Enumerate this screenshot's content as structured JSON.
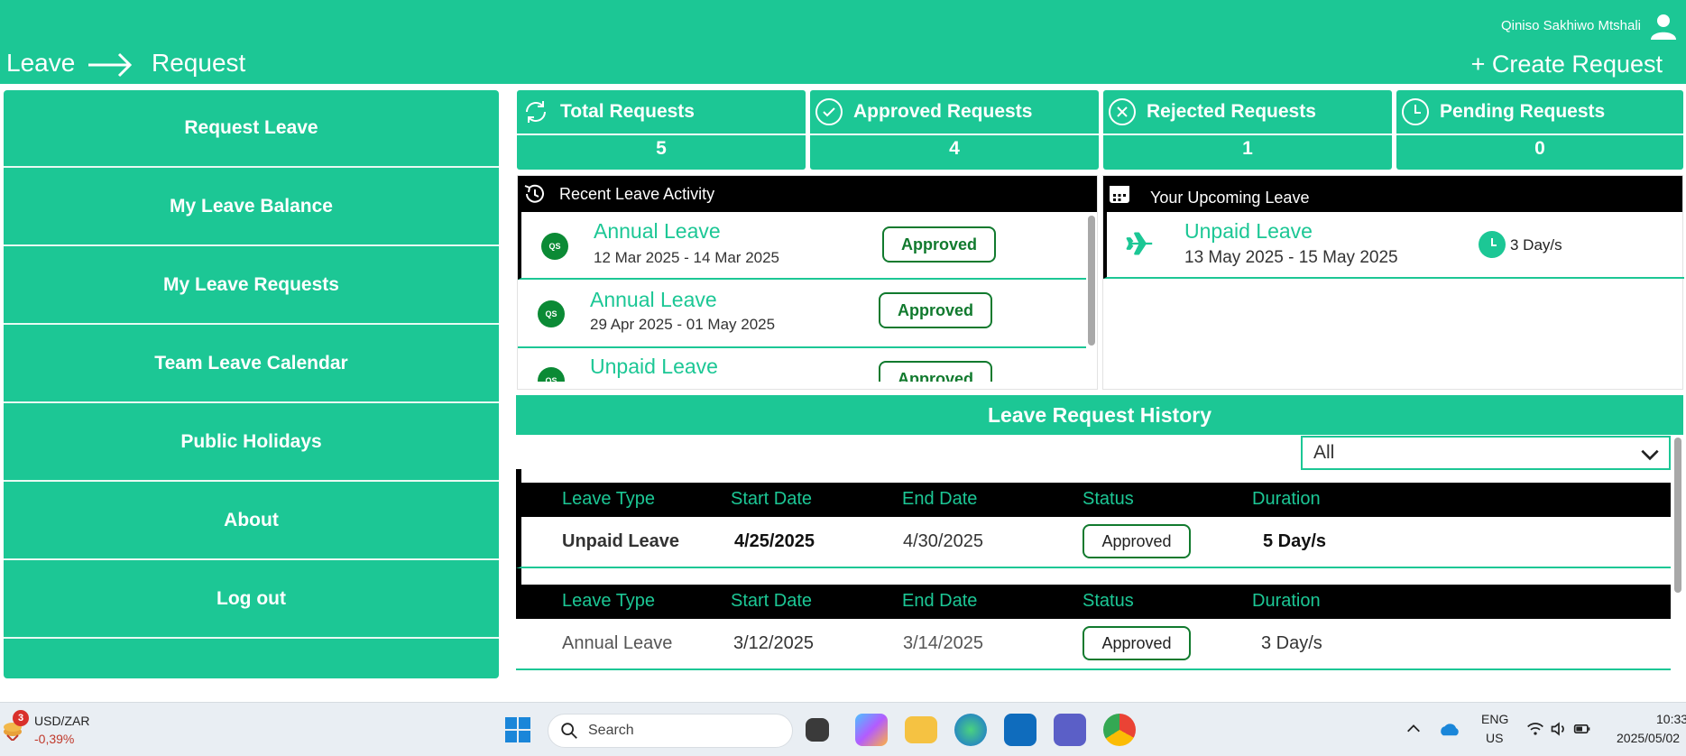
{
  "header": {
    "user_name": "Qiniso Sakhiwo Mtshali",
    "crumb_from": "Leave",
    "crumb_to": "Request",
    "create_label": "+ Create Request"
  },
  "sidebar": {
    "items": [
      {
        "label": "Request Leave"
      },
      {
        "label": "My Leave Balance"
      },
      {
        "label": "My Leave Requests"
      },
      {
        "label": "Team Leave Calendar"
      },
      {
        "label": "Public Holidays"
      },
      {
        "label": "About"
      },
      {
        "label": "Log out"
      }
    ]
  },
  "stats": [
    {
      "label": "Total Requests",
      "value": "5",
      "icon": "refresh-icon"
    },
    {
      "label": "Approved Requests",
      "value": "4",
      "icon": "check-circle-icon"
    },
    {
      "label": "Rejected Requests",
      "value": "1",
      "icon": "x-circle-icon"
    },
    {
      "label": "Pending Requests",
      "value": "0",
      "icon": "clock-icon"
    }
  ],
  "recent": {
    "title": "Recent Leave Activity",
    "items": [
      {
        "initials": "QS",
        "type": "Annual Leave",
        "dates": "12 Mar 2025 - 14 Mar 2025",
        "status": "Approved"
      },
      {
        "initials": "QS",
        "type": "Annual Leave",
        "dates": "29 Apr 2025 - 01 May 2025",
        "status": "Approved"
      },
      {
        "initials": "QS",
        "type": "Unpaid Leave",
        "dates": "",
        "status": "Approved"
      }
    ]
  },
  "upcoming": {
    "title": "Your Upcoming Leave",
    "type": "Unpaid Leave",
    "dates": "13 May 2025 - 15 May 2025",
    "duration": "3 Day/s"
  },
  "history": {
    "title": "Leave Request History",
    "filter_value": "All",
    "columns": [
      "Leave Type",
      "Start Date",
      "End Date",
      "Status",
      "Duration"
    ],
    "rows": [
      {
        "type": "Unpaid Leave",
        "start": "4/25/2025",
        "end": "4/30/2025",
        "status": "Approved",
        "duration": "5 Day/s"
      },
      {
        "type": "Annual Leave",
        "start": "3/12/2025",
        "end": "3/14/2025",
        "status": "Approved",
        "duration": "3 Day/s"
      }
    ]
  },
  "taskbar": {
    "ticker_badge": "3",
    "ticker_name": "USD/ZAR",
    "ticker_change": "-0,39%",
    "search_placeholder": "Search",
    "lang_top": "ENG",
    "lang_bottom": "US",
    "time": "10:33",
    "date": "2025/05/02"
  },
  "colors": {
    "accent": "#1cc795",
    "approved": "#117a2e",
    "header_bg": "#000000"
  }
}
